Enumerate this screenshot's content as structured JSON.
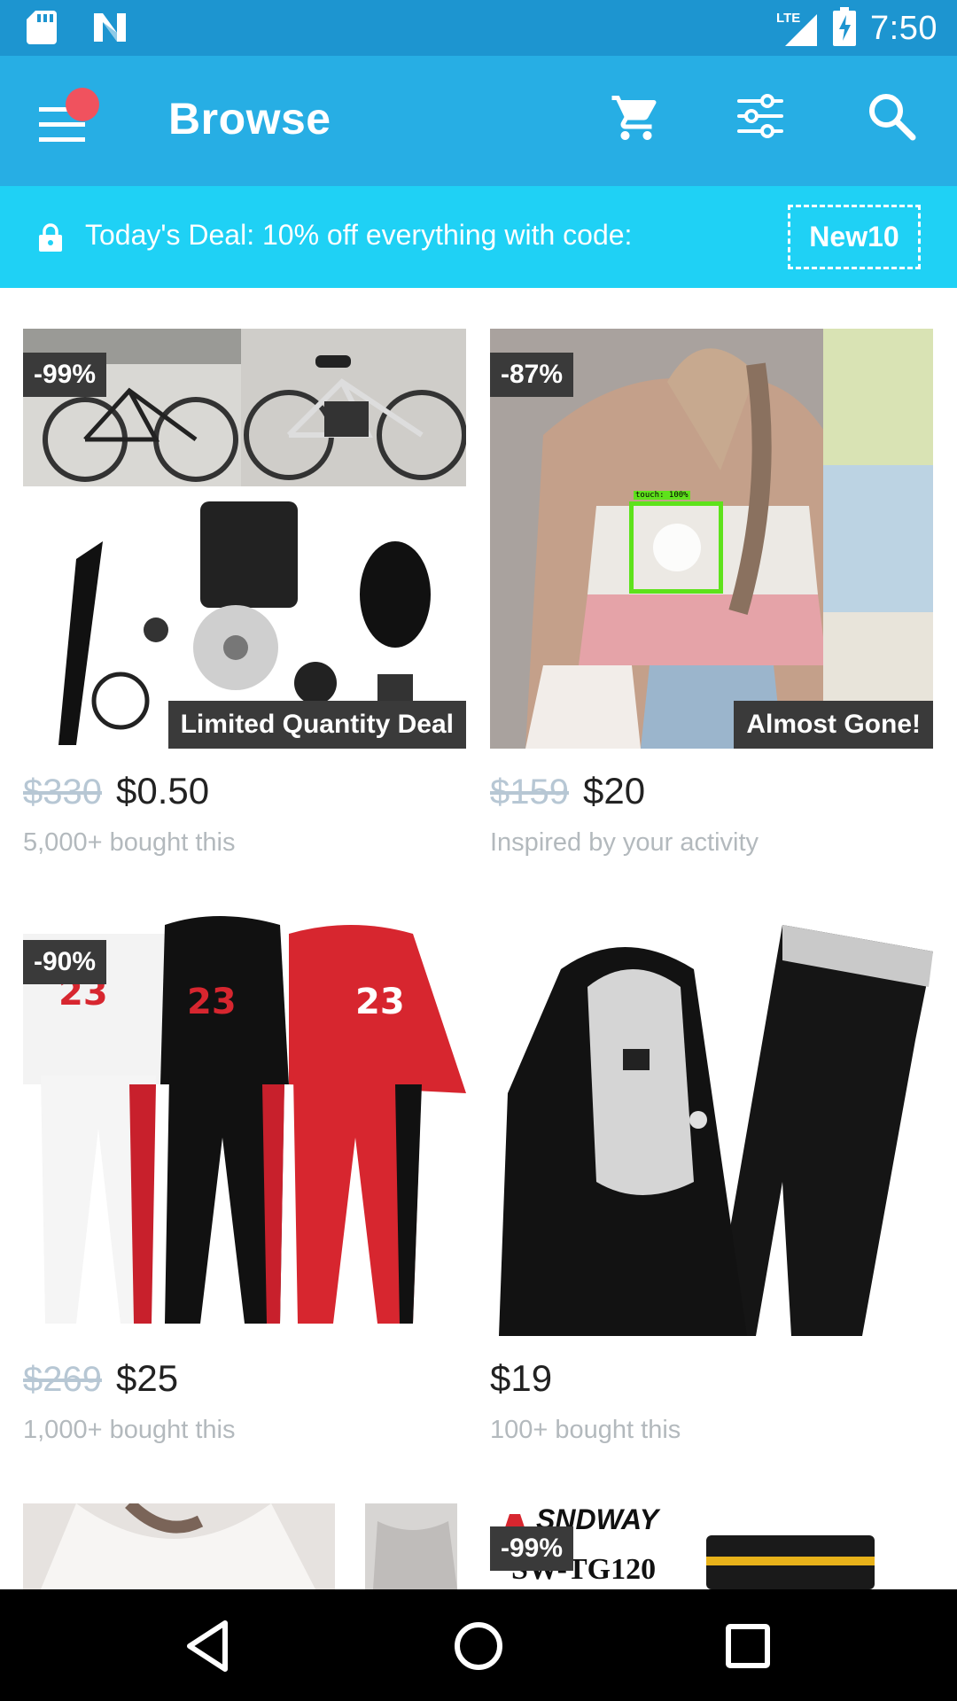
{
  "status_bar": {
    "time": "7:50",
    "network": "LTE"
  },
  "app_bar": {
    "title": "Browse"
  },
  "deal_bar": {
    "text": "Today's Deal: 10% off everything with code:",
    "code": "New10"
  },
  "products": [
    {
      "discount": "-99%",
      "tag": "Limited Quantity Deal",
      "old_price": "$330",
      "price": "$0.50",
      "subtitle": "5,000+ bought this"
    },
    {
      "discount": "-87%",
      "tag": "Almost Gone!",
      "old_price": "$159",
      "price": "$20",
      "subtitle": "Inspired by your activity"
    },
    {
      "discount": "-90%",
      "old_price": "$269",
      "price": "$25",
      "subtitle": "1,000+ bought this"
    },
    {
      "price": "$19",
      "subtitle": "100+ bought this"
    },
    {
      "discount": ""
    },
    {
      "discount": "-99%",
      "brand": "SNDWAY",
      "model": "SW-TG120"
    }
  ],
  "overlay": {
    "touch_label": "touch: 100%"
  },
  "colors": {
    "status_bar": "#1d95d0",
    "app_bar": "#27aee4",
    "deal_bar": "#1fd1f5",
    "notification_dot": "#f0525e",
    "badge": "#3a3a3a"
  }
}
